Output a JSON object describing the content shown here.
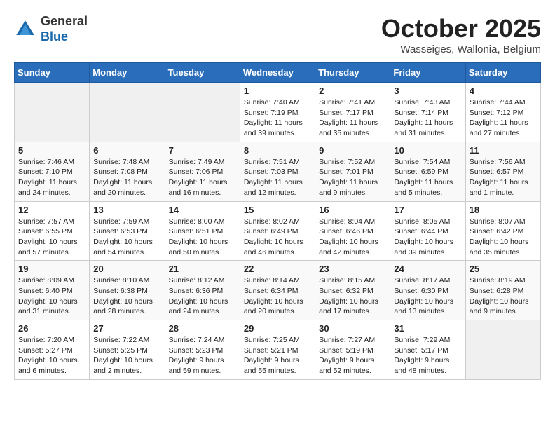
{
  "header": {
    "logo": {
      "general": "General",
      "blue": "Blue"
    },
    "title": "October 2025",
    "location": "Wasseiges, Wallonia, Belgium"
  },
  "weekdays": [
    "Sunday",
    "Monday",
    "Tuesday",
    "Wednesday",
    "Thursday",
    "Friday",
    "Saturday"
  ],
  "weeks": [
    [
      {
        "day": "",
        "empty": true
      },
      {
        "day": "",
        "empty": true
      },
      {
        "day": "",
        "empty": true
      },
      {
        "day": "1",
        "sunrise": "7:40 AM",
        "sunset": "7:19 PM",
        "daylight": "11 hours and 39 minutes."
      },
      {
        "day": "2",
        "sunrise": "7:41 AM",
        "sunset": "7:17 PM",
        "daylight": "11 hours and 35 minutes."
      },
      {
        "day": "3",
        "sunrise": "7:43 AM",
        "sunset": "7:14 PM",
        "daylight": "11 hours and 31 minutes."
      },
      {
        "day": "4",
        "sunrise": "7:44 AM",
        "sunset": "7:12 PM",
        "daylight": "11 hours and 27 minutes."
      }
    ],
    [
      {
        "day": "5",
        "sunrise": "7:46 AM",
        "sunset": "7:10 PM",
        "daylight": "11 hours and 24 minutes."
      },
      {
        "day": "6",
        "sunrise": "7:48 AM",
        "sunset": "7:08 PM",
        "daylight": "11 hours and 20 minutes."
      },
      {
        "day": "7",
        "sunrise": "7:49 AM",
        "sunset": "7:06 PM",
        "daylight": "11 hours and 16 minutes."
      },
      {
        "day": "8",
        "sunrise": "7:51 AM",
        "sunset": "7:03 PM",
        "daylight": "11 hours and 12 minutes."
      },
      {
        "day": "9",
        "sunrise": "7:52 AM",
        "sunset": "7:01 PM",
        "daylight": "11 hours and 9 minutes."
      },
      {
        "day": "10",
        "sunrise": "7:54 AM",
        "sunset": "6:59 PM",
        "daylight": "11 hours and 5 minutes."
      },
      {
        "day": "11",
        "sunrise": "7:56 AM",
        "sunset": "6:57 PM",
        "daylight": "11 hours and 1 minute."
      }
    ],
    [
      {
        "day": "12",
        "sunrise": "7:57 AM",
        "sunset": "6:55 PM",
        "daylight": "10 hours and 57 minutes."
      },
      {
        "day": "13",
        "sunrise": "7:59 AM",
        "sunset": "6:53 PM",
        "daylight": "10 hours and 54 minutes."
      },
      {
        "day": "14",
        "sunrise": "8:00 AM",
        "sunset": "6:51 PM",
        "daylight": "10 hours and 50 minutes."
      },
      {
        "day": "15",
        "sunrise": "8:02 AM",
        "sunset": "6:49 PM",
        "daylight": "10 hours and 46 minutes."
      },
      {
        "day": "16",
        "sunrise": "8:04 AM",
        "sunset": "6:46 PM",
        "daylight": "10 hours and 42 minutes."
      },
      {
        "day": "17",
        "sunrise": "8:05 AM",
        "sunset": "6:44 PM",
        "daylight": "10 hours and 39 minutes."
      },
      {
        "day": "18",
        "sunrise": "8:07 AM",
        "sunset": "6:42 PM",
        "daylight": "10 hours and 35 minutes."
      }
    ],
    [
      {
        "day": "19",
        "sunrise": "8:09 AM",
        "sunset": "6:40 PM",
        "daylight": "10 hours and 31 minutes."
      },
      {
        "day": "20",
        "sunrise": "8:10 AM",
        "sunset": "6:38 PM",
        "daylight": "10 hours and 28 minutes."
      },
      {
        "day": "21",
        "sunrise": "8:12 AM",
        "sunset": "6:36 PM",
        "daylight": "10 hours and 24 minutes."
      },
      {
        "day": "22",
        "sunrise": "8:14 AM",
        "sunset": "6:34 PM",
        "daylight": "10 hours and 20 minutes."
      },
      {
        "day": "23",
        "sunrise": "8:15 AM",
        "sunset": "6:32 PM",
        "daylight": "10 hours and 17 minutes."
      },
      {
        "day": "24",
        "sunrise": "8:17 AM",
        "sunset": "6:30 PM",
        "daylight": "10 hours and 13 minutes."
      },
      {
        "day": "25",
        "sunrise": "8:19 AM",
        "sunset": "6:28 PM",
        "daylight": "10 hours and 9 minutes."
      }
    ],
    [
      {
        "day": "26",
        "sunrise": "7:20 AM",
        "sunset": "5:27 PM",
        "daylight": "10 hours and 6 minutes."
      },
      {
        "day": "27",
        "sunrise": "7:22 AM",
        "sunset": "5:25 PM",
        "daylight": "10 hours and 2 minutes."
      },
      {
        "day": "28",
        "sunrise": "7:24 AM",
        "sunset": "5:23 PM",
        "daylight": "9 hours and 59 minutes."
      },
      {
        "day": "29",
        "sunrise": "7:25 AM",
        "sunset": "5:21 PM",
        "daylight": "9 hours and 55 minutes."
      },
      {
        "day": "30",
        "sunrise": "7:27 AM",
        "sunset": "5:19 PM",
        "daylight": "9 hours and 52 minutes."
      },
      {
        "day": "31",
        "sunrise": "7:29 AM",
        "sunset": "5:17 PM",
        "daylight": "9 hours and 48 minutes."
      },
      {
        "day": "",
        "empty": true
      }
    ]
  ]
}
